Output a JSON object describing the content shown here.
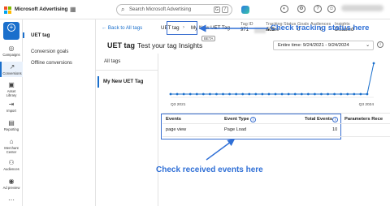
{
  "app": {
    "brand": "Microsoft Advertising",
    "search_placeholder": "Search Microsoft Advertising",
    "search_pills": [
      "G",
      "/"
    ]
  },
  "rail": {
    "create": "Create",
    "items": [
      {
        "label": "Campaigns",
        "icon": "campaigns-icon"
      },
      {
        "label": "Conversions",
        "icon": "conversions-icon",
        "active": true
      },
      {
        "label": "Asset Library",
        "icon": "asset-library-icon"
      },
      {
        "label": "Import",
        "icon": "import-icon"
      },
      {
        "label": "Reporting",
        "icon": "reporting-icon"
      },
      {
        "label": "Merchant Center",
        "icon": "merchant-center-icon"
      },
      {
        "label": "Audiences",
        "icon": "audiences-icon"
      },
      {
        "label": "Ad preview",
        "icon": "ad-preview-icon"
      }
    ]
  },
  "nav": {
    "header": "UET tag",
    "items": [
      "Conversion goals",
      "Offline conversions"
    ]
  },
  "breadcrumb": {
    "back": "Back to All tags",
    "current": "UET tag",
    "tag_name": "My New UET Tag"
  },
  "meta": {
    "tag_id_label": "Tag ID",
    "tag_id_value": "971",
    "tag_id_value_end": "575",
    "status_label": "Tracking Status",
    "status_value": "Active",
    "goals_label": "Goals",
    "goals_value": "0",
    "audiences_label": "Audiences",
    "audiences_value": "0",
    "insights_label": "Insights",
    "insights_value": "Disabled",
    "beta": "BETA"
  },
  "tabs": [
    "UET tag",
    "Test your tag",
    "Insights"
  ],
  "left_list": {
    "all_tags": "All tags",
    "selected": "My New UET Tag"
  },
  "date_range": "Entire time: 9/24/2021 - 9/24/2024",
  "chart_data": {
    "type": "line",
    "x_tick_labels": [
      "Q3 2021",
      "Q3 2024"
    ],
    "y_range_hint": "events over time",
    "points_flat_then_spike": [
      0,
      0,
      0,
      0,
      0,
      0,
      0,
      0,
      0,
      0,
      0,
      0,
      0,
      0,
      0,
      0,
      0,
      0,
      0,
      0,
      0,
      0,
      0,
      0,
      0,
      0,
      0,
      0,
      0,
      0,
      0,
      10
    ],
    "color": "#1a6fcc"
  },
  "table": {
    "headers": [
      "Events",
      "Event Type",
      "Total Events",
      "Parameters Rece"
    ],
    "rows": [
      {
        "event": "page view",
        "type": "Page Load",
        "total": "10"
      }
    ]
  },
  "annotations": {
    "status_callout": "Check tracking status here",
    "events_callout": "Check received events here",
    "color": "#2f6fd6"
  }
}
